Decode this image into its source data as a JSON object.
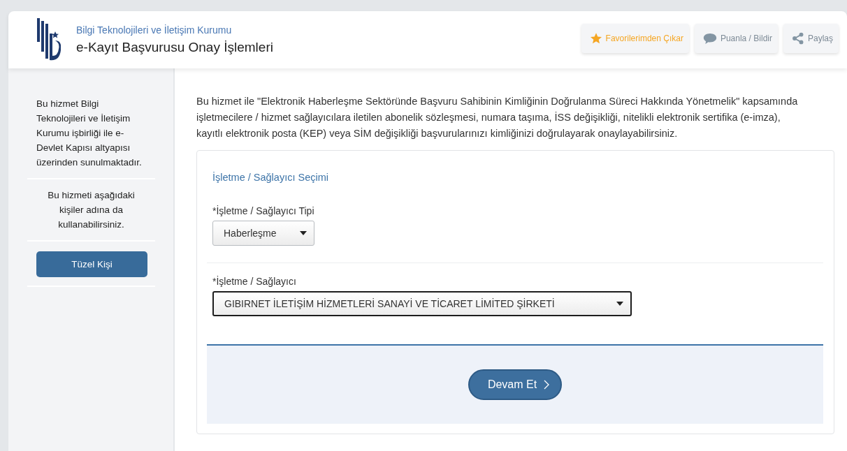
{
  "header": {
    "organization": "Bilgi Teknolojileri ve İletişim Kurumu",
    "title": "e-Kayıt Başvurusu Onay İşlemleri",
    "actions": [
      {
        "kind": "favorite",
        "label": "Favorilerimden Çıkar"
      },
      {
        "kind": "rate",
        "label": "Puanla / Bildir"
      },
      {
        "kind": "share",
        "label": "Paylaş"
      }
    ]
  },
  "sidebar": {
    "info": "Bu hizmet Bilgi Teknolojileri ve İletişim Kurumu işbirliği ile e-Devlet Kapısı altyapısı üzerinden sunulmaktadır.",
    "on_behalf": "Bu hizmeti aşağıdaki kişiler adına da kullanabilirsiniz.",
    "buttons": [
      "Tüzel Kişi"
    ]
  },
  "main": {
    "intro": "Bu hizmet ile \"Elektronik Haberleşme Sektöründe Başvuru Sahibinin Kimliğinin Doğrulanma Süreci Hakkında Yönetmelik\" kapsamında işletmecilere / hizmet sağlayıcılara iletilen abonelik sözleşmesi, numara taşıma, İSS değişikliği, nitelikli elektronik sertifika (e-imza), kayıtlı elektronik posta (KEP) veya SİM değişikliği başvurularınızı kimliğinizi doğrulayarak onaylayabilirsiniz.",
    "section_title": "İşletme / Sağlayıcı Seçimi",
    "fields": [
      {
        "label": "*İşletme / Sağlayıcı Tipi",
        "value": "Haberleşme",
        "focused": false
      },
      {
        "label": "*İşletme / Sağlayıcı",
        "value": "GIBIRNET İLETİŞİM HİZMETLERİ SANAYİ VE TİCARET LİMİTED ŞİRKETİ",
        "focused": true
      }
    ],
    "submit": "Devam Et"
  }
}
